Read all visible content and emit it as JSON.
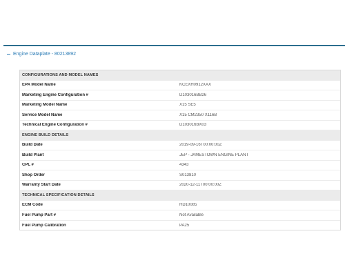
{
  "section": {
    "title": "Engine Dataplate - 80213892"
  },
  "groups": [
    {
      "title": "CONFIGURATIONS AND MODEL NAMES",
      "rows": [
        {
          "label": "EPA Model Name",
          "value": "KCEXH0912XAX"
        },
        {
          "label": "Marketing Engine Configuration #",
          "value": "D103016BB26"
        },
        {
          "label": "Marketing Model Name",
          "value": "X15 SE5"
        },
        {
          "label": "Service Model Name",
          "value": "X15 CM2350 X116B"
        },
        {
          "label": "Technical Engine Configuration #",
          "value": "D103016BX03"
        }
      ]
    },
    {
      "title": "ENGINE BUILD DETAILS",
      "rows": [
        {
          "label": "Build Date",
          "value": "2019-09-16T00:00:00Z"
        },
        {
          "label": "Build Plant",
          "value": "JEP - JAMESTOWN ENGINE PLANT"
        },
        {
          "label": "CPL #",
          "value": "4343"
        },
        {
          "label": "Shop Order",
          "value": "S013810"
        },
        {
          "label": "Warranty Start Date",
          "value": "2020-12-11T00:00:00Z"
        }
      ]
    },
    {
      "title": "TECHNICAL SPECIFICATION DETAILS",
      "rows": [
        {
          "label": "ECM Code",
          "value": "HD10085"
        },
        {
          "label": "Fuel Pump Part #",
          "value": "Not Available"
        },
        {
          "label": "Fuel Pump Calibration",
          "value": "PA25"
        }
      ]
    }
  ]
}
